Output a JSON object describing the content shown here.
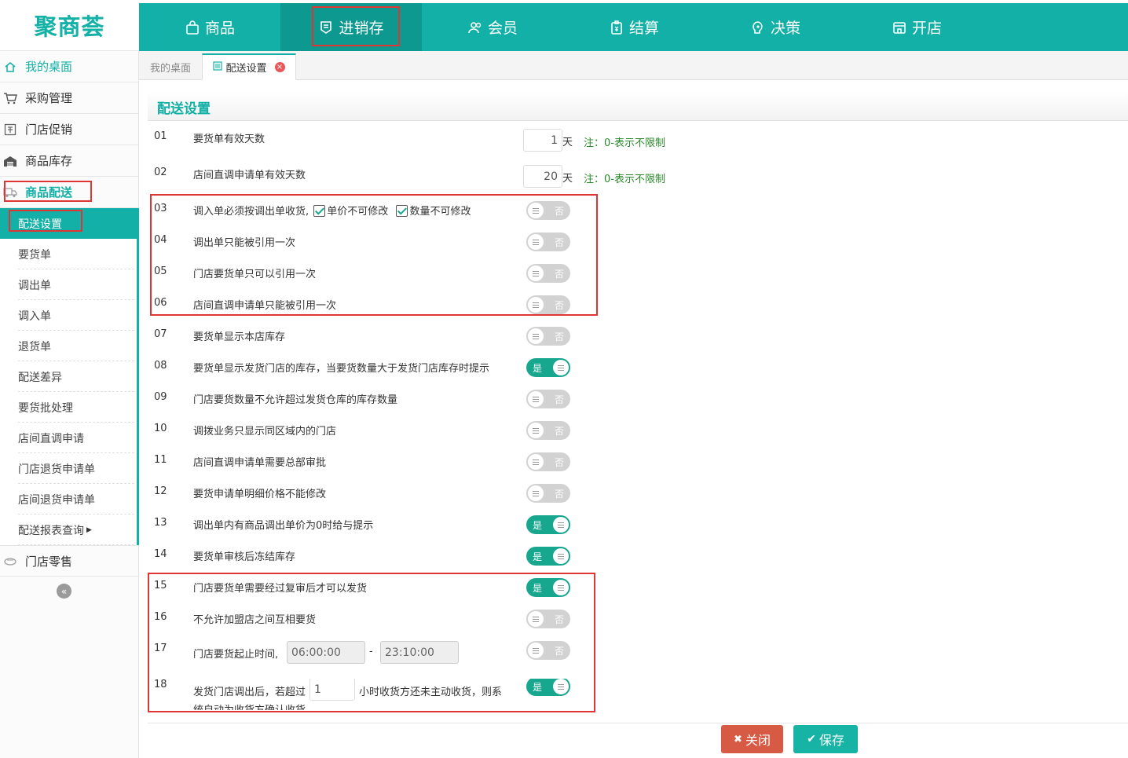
{
  "logo": {
    "text": "聚商荟"
  },
  "topnav": [
    {
      "label": "商品",
      "icon": "bag-icon"
    },
    {
      "label": "进销存",
      "icon": "inventory-icon"
    },
    {
      "label": "会员",
      "icon": "members-icon"
    },
    {
      "label": "结算",
      "icon": "settlement-icon"
    },
    {
      "label": "决策",
      "icon": "decision-icon"
    },
    {
      "label": "开店",
      "icon": "store-icon"
    }
  ],
  "sidebar": {
    "items": [
      {
        "label": "我的桌面",
        "icon": "home-icon"
      },
      {
        "label": "采购管理",
        "icon": "cart-icon"
      },
      {
        "label": "门店促销",
        "icon": "promo-icon"
      },
      {
        "label": "商品库存",
        "icon": "warehouse-icon"
      },
      {
        "label": "商品配送",
        "icon": "truck-icon"
      }
    ],
    "subitems": [
      "配送设置",
      "要货单",
      "调出单",
      "调入单",
      "退货单",
      "配送差异",
      "要货批处理",
      "店间直调申请",
      "门店退货申请单",
      "店间退货申请单",
      "配送报表查询"
    ],
    "retail": {
      "label": "门店零售",
      "icon": "retail-icon"
    },
    "collapse_glyph": "«"
  },
  "tabs": [
    {
      "label": "我的桌面"
    },
    {
      "label": "配送设置",
      "close": "×"
    }
  ],
  "section_title": "配送设置",
  "rows": [
    {
      "num": "01",
      "label": "要货单有效天数",
      "value": "1",
      "unit": "天",
      "note": "注：0-表示不限制"
    },
    {
      "num": "02",
      "label": "店间直调申请单有效天数",
      "value": "20",
      "unit": "天",
      "note": "注：0-表示不限制"
    },
    {
      "num": "03",
      "label": "调入单必须按调出单收货,",
      "check1": "单价不可修改",
      "check2": "数量不可修改",
      "toggle": "否"
    },
    {
      "num": "04",
      "label": "调出单只能被引用一次",
      "toggle": "否"
    },
    {
      "num": "05",
      "label": "门店要货单只可以引用一次",
      "toggle": "否"
    },
    {
      "num": "06",
      "label": "店间直调申请单只能被引用一次",
      "toggle": "否"
    },
    {
      "num": "07",
      "label": "要货单显示本店库存",
      "toggle": "否"
    },
    {
      "num": "08",
      "label": "要货单显示发货门店的库存，当要货数量大于发货门店库存时提示",
      "toggle": "是"
    },
    {
      "num": "09",
      "label": "门店要货数量不允许超过发货仓库的库存数量",
      "toggle": "否"
    },
    {
      "num": "10",
      "label": "调拨业务只显示同区域内的门店",
      "toggle": "否"
    },
    {
      "num": "11",
      "label": "店间直调申请单需要总部审批",
      "toggle": "否"
    },
    {
      "num": "12",
      "label": "要货申请单明细价格不能修改",
      "toggle": "否"
    },
    {
      "num": "13",
      "label": "调出单内有商品调出单价为0时给与提示",
      "toggle": "是"
    },
    {
      "num": "14",
      "label": "要货单审核后冻结库存",
      "toggle": "是"
    },
    {
      "num": "15",
      "label": "门店要货单需要经过复审后才可以发货",
      "toggle": "是"
    },
    {
      "num": "16",
      "label": "不允许加盟店之间互相要货",
      "toggle": "否"
    },
    {
      "num": "17",
      "label": "门店要货起止时间,",
      "start": "06:00:00",
      "sep": "-",
      "end": "23:10:00",
      "toggle": "否"
    },
    {
      "num": "18",
      "label_a": "发货门店调出后，若超过",
      "hours": "1",
      "label_b": "小时收货方还未主动收货，则系",
      "label_c": "统自动为收货方确认收货",
      "toggle": "是"
    }
  ],
  "footer": {
    "close_label": "关闭",
    "save_label": "保存",
    "close_glyph": "✖",
    "save_glyph": "✔"
  },
  "colors": {
    "accent": "#12b0a6",
    "on": "#17a68e",
    "off": "#d2d2d2",
    "highlight": "#e03535",
    "close_btn": "#d65a44",
    "save_btn": "#17b3a4"
  }
}
